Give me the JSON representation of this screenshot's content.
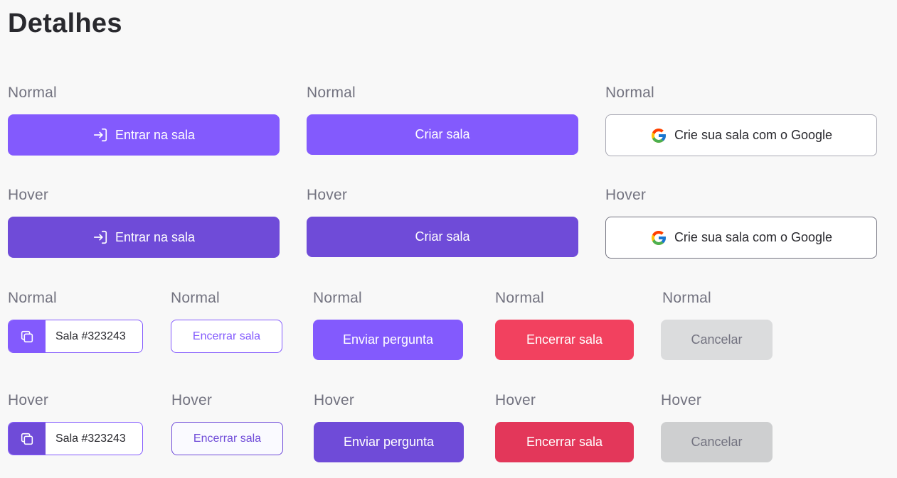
{
  "page": {
    "title": "Detalhes"
  },
  "labels": {
    "normal": "Normal",
    "hover": "Hover"
  },
  "buttons": {
    "enter_room": "Entrar na sala",
    "create_room": "Criar sala",
    "google": "Crie sua sala com o Google",
    "room_code": "Sala #323243",
    "close_room": "Encerrar sala",
    "send_question": "Enviar pergunta",
    "cancel": "Cancelar"
  },
  "icons": {
    "enter": "log-in-icon",
    "google": "google-logo-icon",
    "copy": "copy-icon"
  },
  "colors": {
    "purple": "#835afd",
    "purple_hover": "#6f4bd8",
    "red": "#f2415f",
    "red_hover": "#e3375a",
    "gray": "#dbdcdd",
    "gray_hover": "#cecfd0",
    "text_dark": "#29292e",
    "text_muted": "#737380",
    "background": "#f8f8f8"
  }
}
